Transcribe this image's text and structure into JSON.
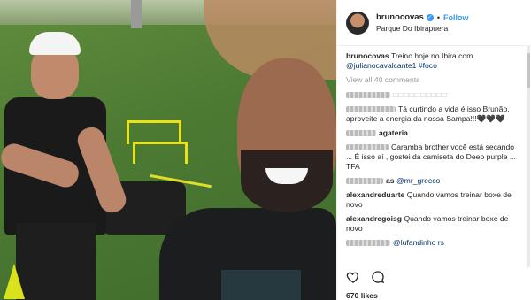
{
  "post": {
    "username": "brunocovas",
    "follow_label": "Follow",
    "location": "Parque Do Ibirapuera"
  },
  "caption": {
    "username": "brunocovas",
    "text": "Treino hoje no Ibira com",
    "mention": "@julianocavalcante1",
    "hashtag": "#foco"
  },
  "view_all": "View all 40 comments",
  "comments": [
    {
      "user_visible": "",
      "text": "",
      "has_emojis": true
    },
    {
      "user_visible": "",
      "text": "Tá curtindo a vida é isso Brunão, aproveite a energia da nossa Sampa!!!🖤🖤🖤"
    },
    {
      "user_visible": "agateria",
      "text": ""
    },
    {
      "user_visible": "",
      "text": "Caramba brother você está secando ... É isso aí , gostei da camiseta do Deep purple ... TFA"
    },
    {
      "user_visible": "as",
      "text": "@mr_grecco"
    },
    {
      "user_visible": "alexandreduarte",
      "text": "Quando vamos treinar boxe de novo"
    },
    {
      "user_visible": "alexandregoisg",
      "text": "Quando vamos treinar boxe de novo"
    },
    {
      "user_visible": "",
      "text": "@lufandinho rs"
    }
  ],
  "likes": "670 likes",
  "icons": {
    "heart": "heart-icon",
    "comment": "comment-icon"
  }
}
